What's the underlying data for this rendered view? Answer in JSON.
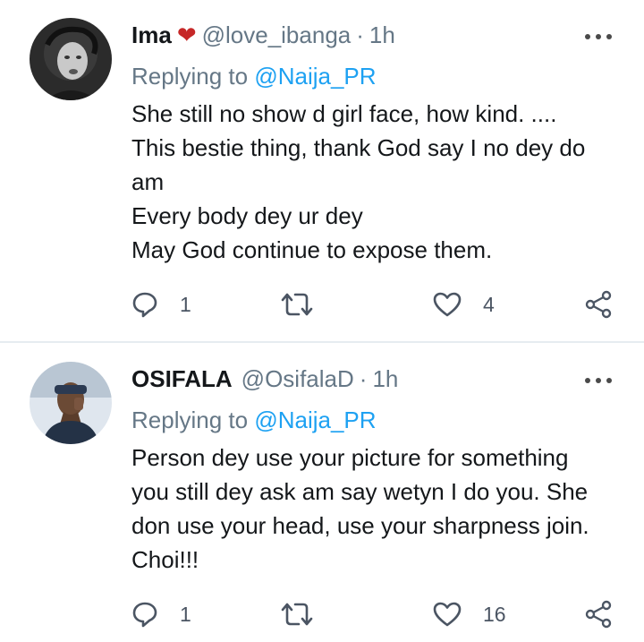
{
  "tweets": [
    {
      "name": "Ima",
      "handle": "@love_ibanga",
      "separator": "·",
      "time": "1h",
      "replying_prefix": "Replying to",
      "replying_to": "@Naija_PR",
      "lines": [
        "She still no show d girl face, how kind. ....",
        "This bestie thing, thank God say I no dey do",
        "am",
        "Every body dey ur dey",
        "May God continue to expose them."
      ],
      "replies": "1",
      "likes": "4"
    },
    {
      "name": "OSIFALA",
      "handle": "@OsifalaD",
      "separator": "·",
      "time": "1h",
      "replying_prefix": "Replying to",
      "replying_to": "@Naija_PR",
      "lines": [
        "Person dey use your picture for something",
        "you still dey ask am say wetyn I do you. She",
        "don use your head, use your sharpness join.",
        "Choi!!!"
      ],
      "replies": "1",
      "likes": "16"
    }
  ],
  "icons": {
    "heart_emoji": "❤",
    "reply": "reply-icon",
    "retweet": "retweet-icon",
    "like": "like-icon",
    "share": "share-icon",
    "more": "more-icon"
  },
  "colors": {
    "mention": "#1da1f2",
    "secondary_text": "#657786",
    "heart": "#c62828",
    "divider": "#e6ecf0"
  }
}
